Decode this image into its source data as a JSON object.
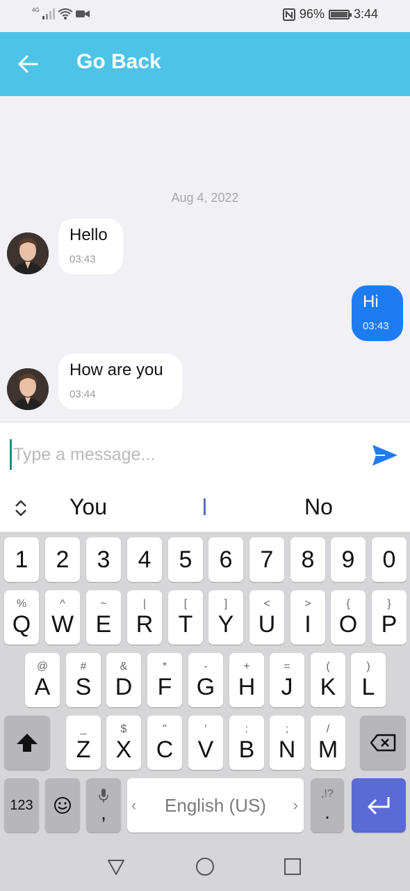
{
  "status_bar": {
    "network_label": "4G",
    "battery": "96%",
    "time": "3:44"
  },
  "app_bar": {
    "title": "Go Back"
  },
  "chat": {
    "date": "Aug 4, 2022",
    "messages": [
      {
        "direction": "incoming",
        "text": "Hello",
        "time": "03:43"
      },
      {
        "direction": "outgoing",
        "text": "Hi",
        "time": "03:43"
      },
      {
        "direction": "incoming",
        "text": "How are you",
        "time": "03:44"
      }
    ]
  },
  "composer": {
    "value": "",
    "placeholder": "Type a message..."
  },
  "suggestions": {
    "items": [
      "You",
      "I",
      "No"
    ]
  },
  "keyboard": {
    "row1": [
      "1",
      "2",
      "3",
      "4",
      "5",
      "6",
      "7",
      "8",
      "9",
      "0"
    ],
    "row2": [
      {
        "main": "Q",
        "alt": "%"
      },
      {
        "main": "W",
        "alt": "^"
      },
      {
        "main": "E",
        "alt": "~"
      },
      {
        "main": "R",
        "alt": "|"
      },
      {
        "main": "T",
        "alt": "["
      },
      {
        "main": "Y",
        "alt": "]"
      },
      {
        "main": "U",
        "alt": "<"
      },
      {
        "main": "I",
        "alt": ">"
      },
      {
        "main": "O",
        "alt": "{"
      },
      {
        "main": "P",
        "alt": "}"
      }
    ],
    "row3": [
      {
        "main": "A",
        "alt": "@"
      },
      {
        "main": "S",
        "alt": "#"
      },
      {
        "main": "D",
        "alt": "&"
      },
      {
        "main": "F",
        "alt": "*"
      },
      {
        "main": "G",
        "alt": "-"
      },
      {
        "main": "H",
        "alt": "+"
      },
      {
        "main": "J",
        "alt": "="
      },
      {
        "main": "K",
        "alt": "("
      },
      {
        "main": "L",
        "alt": ")"
      }
    ],
    "row4": [
      {
        "main": "Z",
        "alt": "_"
      },
      {
        "main": "X",
        "alt": "$"
      },
      {
        "main": "C",
        "alt": "\""
      },
      {
        "main": "V",
        "alt": "'"
      },
      {
        "main": "B",
        "alt": ":"
      },
      {
        "main": "N",
        "alt": ";"
      },
      {
        "main": "M",
        "alt": "/"
      }
    ],
    "num_label": "123",
    "comma_label": ",",
    "space_label": "English (US)",
    "space_left_arrow": "‹",
    "space_right_arrow": "›",
    "period_label": ".",
    "period_alt": ",!?",
    "colors": {
      "enter_key": "#5a6ad6",
      "accent": "#4dc3e6",
      "outgoing_bubble": "#1e7cf2"
    }
  }
}
